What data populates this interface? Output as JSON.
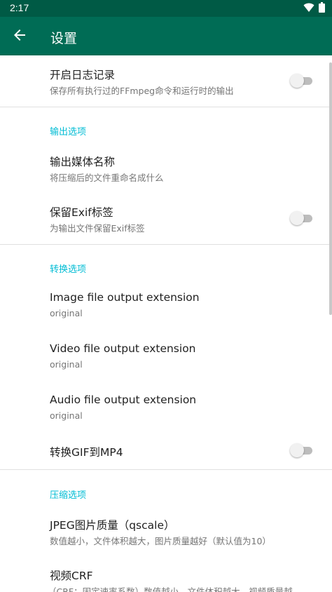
{
  "status_bar": {
    "time": "2:17"
  },
  "app_bar": {
    "title": "设置"
  },
  "sections": {
    "logging": {
      "enable_log": {
        "title": "开启日志记录",
        "summary": "保存所有执行过的FFmpeg命令和运行时的输出",
        "checked": false
      }
    },
    "output": {
      "header": "输出选项",
      "media_name": {
        "title": "输出媒体名称",
        "summary": "将压缩后的文件重命名成什么"
      },
      "keep_exif": {
        "title": "保留Exif标签",
        "summary": "为输出文件保留Exif标签",
        "checked": false
      }
    },
    "conversion": {
      "header": "转换选项",
      "image_ext": {
        "title": "Image file output extension",
        "summary": "original"
      },
      "video_ext": {
        "title": "Video file output extension",
        "summary": "original"
      },
      "audio_ext": {
        "title": "Audio file output extension",
        "summary": "original"
      },
      "gif_to_mp4": {
        "title": "转换GIF到MP4",
        "checked": false
      }
    },
    "compression": {
      "header": "压缩选项",
      "jpeg_quality": {
        "title": "JPEG图片质量（qscale）",
        "summary": "数值越小，文件体积越大，图片质量越好（默认值为10）"
      },
      "video_crf": {
        "title": "视频CRF",
        "summary": "（CRF：固定速率系数）数值越小，文件体积越大，视频质量越"
      }
    }
  },
  "colors": {
    "status_bar": "#005a45",
    "app_bar": "#006c55",
    "accent": "#00bcd4"
  },
  "icons": {
    "back": "arrow-left-icon",
    "wifi": "wifi-icon",
    "battery": "battery-icon"
  }
}
